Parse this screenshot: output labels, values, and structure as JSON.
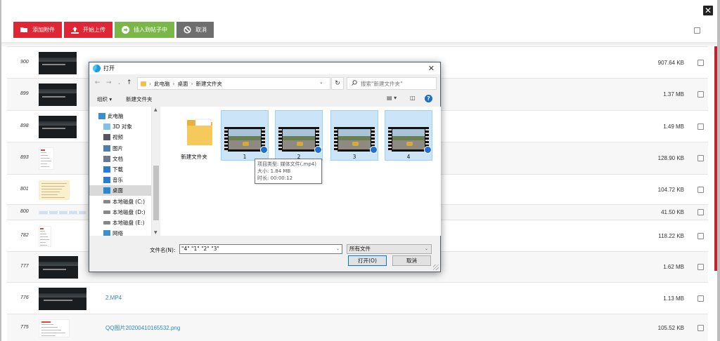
{
  "toolbar": {
    "add_attachment": "添加附件",
    "start_upload": "开始上传",
    "insert_post": "插入到帖子中",
    "cancel": "取消"
  },
  "rows": [
    {
      "num": "900",
      "name": "",
      "size": "907.64 KB",
      "thumb": "video"
    },
    {
      "num": "899",
      "name": "",
      "size": "1.37 MB",
      "thumb": "video"
    },
    {
      "num": "898",
      "name": "",
      "size": "1.49 MB",
      "thumb": "video"
    },
    {
      "num": "893",
      "name": "",
      "size": "128.90 KB",
      "thumb": "doc"
    },
    {
      "num": "801",
      "name": "",
      "size": "104.72 KB",
      "thumb": "yellow"
    },
    {
      "num": "800",
      "name": "",
      "size": "41.50 KB",
      "thumb": "table"
    },
    {
      "num": "782",
      "name": "",
      "size": "118.22 KB",
      "thumb": "doc"
    },
    {
      "num": "777",
      "name": "",
      "size": "1.62 MB",
      "thumb": "video"
    },
    {
      "num": "776",
      "name": "2.MP4",
      "size": "1.13 MB",
      "thumb": "video"
    },
    {
      "num": "775",
      "name": "QQ图片20200410165532.png",
      "size": "105.52 KB",
      "thumb": "doc"
    }
  ],
  "dialog": {
    "title": "打开",
    "address": {
      "root": "此电脑",
      "crumbs": [
        "此电脑",
        "桌面",
        "新建文件夹"
      ]
    },
    "search_placeholder": "搜索\"新建文件夹\"",
    "organize": "组织",
    "new_folder": "新建文件夹",
    "tree": [
      {
        "label": "此电脑",
        "icon": "computer-icon"
      },
      {
        "label": "3D 对象",
        "icon": "3d-objects-icon"
      },
      {
        "label": "视频",
        "icon": "videos-icon"
      },
      {
        "label": "图片",
        "icon": "pictures-icon"
      },
      {
        "label": "文档",
        "icon": "documents-icon"
      },
      {
        "label": "下载",
        "icon": "downloads-icon"
      },
      {
        "label": "音乐",
        "icon": "music-icon"
      },
      {
        "label": "桌面",
        "icon": "desktop-icon"
      },
      {
        "label": "本地磁盘 (C:)",
        "icon": "drive-icon"
      },
      {
        "label": "本地磁盘 (D:)",
        "icon": "drive-icon"
      },
      {
        "label": "本地磁盘 (E:)",
        "icon": "drive-icon"
      },
      {
        "label": "网络",
        "icon": "network-icon"
      }
    ],
    "files": [
      {
        "name": "新建文件夹",
        "type": "folder"
      },
      {
        "name": "1",
        "type": "video"
      },
      {
        "name": "2",
        "type": "video"
      },
      {
        "name": "3",
        "type": "video"
      },
      {
        "name": "4",
        "type": "video"
      }
    ],
    "tooltip": {
      "type": "项目类型: 媒体文件(.mp4)",
      "size": "大小: 1.84 MB",
      "duration": "时长: 00:00:12"
    },
    "filename_label": "文件名(N):",
    "filename_value": "\"4\" \"1\" \"2\" \"3\"",
    "filetype": "所有文件",
    "open_button": "打开(O)",
    "cancel_button": "取消"
  }
}
